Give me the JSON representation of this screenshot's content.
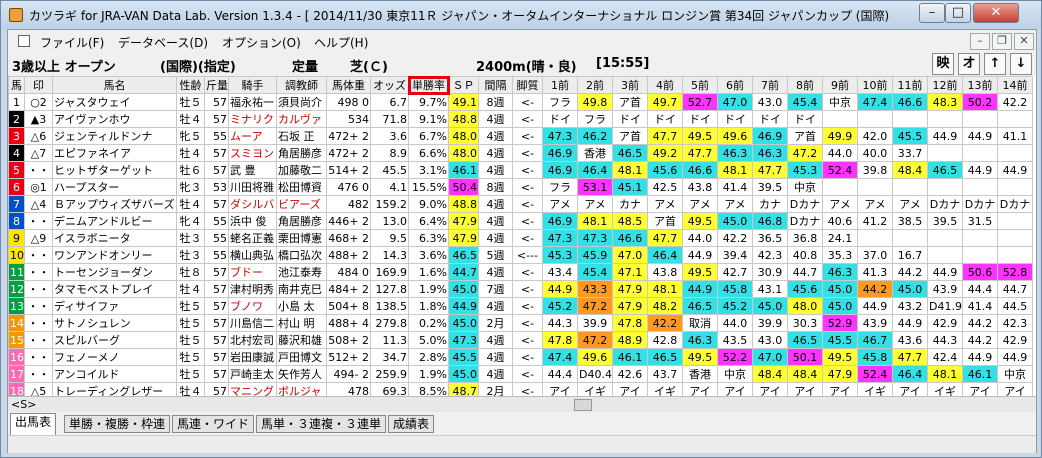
{
  "window": {
    "title": "カツラギ for JRA-VAN Data Lab. Version 1.3.4 - [ 2014/11/30 東京11Ｒ ジャパン・オータムインターナショナル ロンジン賞 第34回 ジャパンカップ (国際)"
  },
  "menu": {
    "items": [
      "ファイル(F)",
      "データベース(D)",
      "オプション(O)",
      "ヘルプ(H)"
    ]
  },
  "race": {
    "class": "3歳以上 オープン",
    "condition": "(国際)(指定)",
    "weight": "定量",
    "surface": "芝(Ｃ)",
    "distance": "2400m(晴・良)",
    "time": "[15:55]"
  },
  "nav": {
    "buttons": [
      "映",
      "オ",
      "↑",
      "↓"
    ]
  },
  "columns": [
    "馬",
    "印",
    "馬名",
    "性齢",
    "斤量",
    "騎手",
    "調教師",
    "馬体重",
    "オッズ",
    "単勝率",
    "ＳＰ",
    "間隔",
    "脚質",
    "1前",
    "2前",
    "3前",
    "4前",
    "5前",
    "6前",
    "7前",
    "8前",
    "9前",
    "10前",
    "11前",
    "12前",
    "13前",
    "14前"
  ],
  "rows": [
    {
      "no": "1",
      "mark": "○2",
      "name": "ジャスタウェイ",
      "sexage": "牡５",
      "kin": "57",
      "jockey": "福永祐一",
      "trainer": "須貝尚介",
      "weight": "498  0",
      "odds": "6.7",
      "rate": "9.7%",
      "sp": "49.1",
      "kankaku": "8週",
      "kyaku": "<-",
      "past": [
        "フラ",
        "49.8",
        "ア首",
        "49.7",
        "52.7",
        "47.0",
        "43.0",
        "45.4",
        "中京",
        "47.4",
        "46.6",
        "48.3",
        "50.2",
        "42.2"
      ]
    },
    {
      "no": "2",
      "mark": "▲3",
      "name": "アイヴァンホウ",
      "sexage": "牡４",
      "kin": "57",
      "jockey": "ミナリク",
      "trainer": "カルヴァ",
      "weight": "534",
      "odds": "71.8",
      "rate": "9.1%",
      "sp": "48.8",
      "kankaku": "4週",
      "kyaku": "<-",
      "past": [
        "ドイ",
        "フラ",
        "ドイ",
        "ドイ",
        "ドイ",
        "ドイ",
        "ドイ",
        "ドイ",
        "",
        "",
        "",
        "",
        "",
        ""
      ]
    },
    {
      "no": "3",
      "mark": "△6",
      "name": "ジェンティルドンナ",
      "sexage": "牝５",
      "kin": "55",
      "jockey": "ムーア",
      "trainer": "石坂  正",
      "weight": "472+ 2",
      "odds": "3.6",
      "rate": "6.7%",
      "sp": "48.0",
      "kankaku": "4週",
      "kyaku": "<-",
      "past": [
        "47.3",
        "46.2",
        "ア首",
        "47.7",
        "49.5",
        "49.6",
        "46.9",
        "ア首",
        "49.9",
        "42.0",
        "45.5",
        "44.9",
        "44.9",
        "41.1"
      ]
    },
    {
      "no": "4",
      "mark": "△7",
      "name": "エピファネイア",
      "sexage": "牡４",
      "kin": "57",
      "jockey": "スミヨン",
      "trainer": "角居勝彦",
      "weight": "472+ 2",
      "odds": "8.9",
      "rate": "6.6%",
      "sp": "48.0",
      "kankaku": "4週",
      "kyaku": "<-",
      "past": [
        "46.9",
        "香港",
        "46.5",
        "49.2",
        "47.7",
        "46.3",
        "46.3",
        "47.2",
        "44.0",
        "40.0",
        "33.7",
        "",
        "",
        ""
      ]
    },
    {
      "no": "5",
      "mark": "・・",
      "name": "ヒットザターゲット",
      "sexage": "牡６",
      "kin": "57",
      "jockey": "武    豊",
      "trainer": "加藤敬二",
      "weight": "514+ 2",
      "odds": "45.5",
      "rate": "3.1%",
      "sp": "46.1",
      "kankaku": "4週",
      "kyaku": "<-",
      "past": [
        "46.9",
        "46.4",
        "48.1",
        "45.6",
        "46.6",
        "48.1",
        "47.7",
        "45.3",
        "52.4",
        "39.8",
        "48.4",
        "46.5",
        "44.9",
        "44.9"
      ]
    },
    {
      "no": "6",
      "mark": "◎1",
      "name": "ハープスター",
      "sexage": "牝３",
      "kin": "53",
      "jockey": "川田将雅",
      "trainer": "松田博資",
      "weight": "476  0",
      "odds": "4.1",
      "rate": "15.5%",
      "sp": "50.4",
      "kankaku": "8週",
      "kyaku": "<-",
      "past": [
        "フラ",
        "53.1",
        "45.1",
        "42.5",
        "43.8",
        "41.4",
        "39.5",
        "中京",
        "",
        "",
        "",
        "",
        "",
        ""
      ]
    },
    {
      "no": "7",
      "mark": "△4",
      "name": "Ｂアップウィズザバーズ",
      "sexage": "牡４",
      "kin": "57",
      "jockey": "ダシルバ",
      "trainer": "ビアーズ",
      "weight": "482",
      "odds": "159.2",
      "rate": "9.0%",
      "sp": "48.8",
      "kankaku": "4週",
      "kyaku": "<-",
      "past": [
        "アメ",
        "アメ",
        "カナ",
        "アメ",
        "アメ",
        "アメ",
        "カナ",
        "Dカナ",
        "アメ",
        "アメ",
        "アメ",
        "Dカナ",
        "Dカナ",
        "Dカナ"
      ]
    },
    {
      "no": "8",
      "mark": "・・",
      "name": "デニムアンドルビー",
      "sexage": "牝４",
      "kin": "55",
      "jockey": "浜中  俊",
      "trainer": "角居勝彦",
      "weight": "446+ 2",
      "odds": "13.0",
      "rate": "6.4%",
      "sp": "47.9",
      "kankaku": "4週",
      "kyaku": "<-",
      "past": [
        "46.9",
        "48.1",
        "48.5",
        "ア首",
        "49.5",
        "45.0",
        "46.8",
        "Dカナ",
        "40.6",
        "41.2",
        "38.5",
        "39.5",
        "31.5",
        ""
      ]
    },
    {
      "no": "9",
      "mark": "△9",
      "name": "イスラボニータ",
      "sexage": "牡３",
      "kin": "55",
      "jockey": "蛯名正義",
      "trainer": "栗田博憲",
      "weight": "468+ 2",
      "odds": "9.5",
      "rate": "6.3%",
      "sp": "47.9",
      "kankaku": "4週",
      "kyaku": "<-",
      "past": [
        "47.3",
        "47.3",
        "46.6",
        "47.7",
        "44.0",
        "42.2",
        "36.5",
        "36.8",
        "24.1",
        "",
        "",
        "",
        "",
        ""
      ]
    },
    {
      "no": "10",
      "mark": "・・",
      "name": "ワンアンドオンリー",
      "sexage": "牡３",
      "kin": "55",
      "jockey": "横山典弘",
      "trainer": "橋口弘次",
      "weight": "488+ 2",
      "odds": "14.3",
      "rate": "3.6%",
      "sp": "46.5",
      "kankaku": "5週",
      "kyaku": "<---",
      "past": [
        "45.3",
        "45.9",
        "47.0",
        "46.4",
        "44.9",
        "39.4",
        "42.3",
        "40.8",
        "35.3",
        "37.0",
        "16.7",
        "",
        "",
        ""
      ]
    },
    {
      "no": "11",
      "mark": "・・",
      "name": "トーセンジョーダン",
      "sexage": "牡８",
      "kin": "57",
      "jockey": "ブドー",
      "trainer": "池江泰寿",
      "weight": "484  0",
      "odds": "169.9",
      "rate": "1.6%",
      "sp": "44.7",
      "kankaku": "4週",
      "kyaku": "<-",
      "past": [
        "43.4",
        "45.4",
        "47.1",
        "43.8",
        "49.5",
        "42.7",
        "30.9",
        "44.7",
        "46.3",
        "41.3",
        "44.2",
        "44.9",
        "50.6",
        "52.8"
      ]
    },
    {
      "no": "12",
      "mark": "・・",
      "name": "タマモベストプレイ",
      "sexage": "牡４",
      "kin": "57",
      "jockey": "津村明秀",
      "trainer": "南井克巳",
      "weight": "484+ 2",
      "odds": "127.8",
      "rate": "1.9%",
      "sp": "45.0",
      "kankaku": "7週",
      "kyaku": "<-",
      "past": [
        "44.9",
        "43.3",
        "47.9",
        "48.1",
        "44.9",
        "45.8",
        "43.1",
        "45.6",
        "45.0",
        "44.2",
        "45.0",
        "43.9",
        "44.4",
        "44.7"
      ]
    },
    {
      "no": "13",
      "mark": "・・",
      "name": "ディサイファ",
      "sexage": "牡５",
      "kin": "57",
      "jockey": "ブノワ",
      "trainer": "小島  太",
      "weight": "504+ 8",
      "odds": "138.5",
      "rate": "1.8%",
      "sp": "44.9",
      "kankaku": "4週",
      "kyaku": "<-",
      "past": [
        "45.2",
        "47.2",
        "47.9",
        "48.2",
        "46.5",
        "45.2",
        "45.0",
        "48.0",
        "45.0",
        "44.9",
        "43.2",
        "D41.9",
        "41.4",
        "44.5"
      ]
    },
    {
      "no": "14",
      "mark": "・・",
      "name": "サトノシュレン",
      "sexage": "牡５",
      "kin": "57",
      "jockey": "川島信二",
      "trainer": "村山  明",
      "weight": "488+ 4",
      "odds": "279.8",
      "rate": "0.2%",
      "sp": "45.0",
      "kankaku": "2月",
      "kyaku": "<-",
      "past": [
        "44.3",
        "39.9",
        "47.8",
        "42.2",
        "取消",
        "44.0",
        "39.9",
        "30.3",
        "52.9",
        "43.9",
        "44.9",
        "42.9",
        "44.2",
        "42.3"
      ]
    },
    {
      "no": "15",
      "mark": "・・",
      "name": "スピルバーグ",
      "sexage": "牡５",
      "kin": "57",
      "jockey": "北村宏司",
      "trainer": "藤沢和雄",
      "weight": "508+ 2",
      "odds": "11.3",
      "rate": "5.0%",
      "sp": "47.3",
      "kankaku": "4週",
      "kyaku": "<-",
      "past": [
        "47.8",
        "47.2",
        "48.9",
        "42.8",
        "46.3",
        "43.5",
        "43.0",
        "46.5",
        "45.5",
        "46.7",
        "43.6",
        "44.3",
        "44.2",
        "42.9"
      ]
    },
    {
      "no": "16",
      "mark": "・・",
      "name": "フェノーメノ",
      "sexage": "牡５",
      "kin": "57",
      "jockey": "岩田康誠",
      "trainer": "戸田博文",
      "weight": "512+ 2",
      "odds": "34.7",
      "rate": "2.8%",
      "sp": "45.5",
      "kankaku": "4週",
      "kyaku": "<-",
      "past": [
        "47.4",
        "49.6",
        "46.1",
        "46.5",
        "49.5",
        "52.2",
        "47.0",
        "50.1",
        "49.5",
        "45.8",
        "47.7",
        "42.4",
        "44.9",
        "44.9"
      ]
    },
    {
      "no": "17",
      "mark": "・・",
      "name": "アンコイルド",
      "sexage": "牡５",
      "kin": "57",
      "jockey": "戸崎圭太",
      "trainer": "矢作芳人",
      "weight": "494- 2",
      "odds": "259.9",
      "rate": "1.9%",
      "sp": "45.0",
      "kankaku": "4週",
      "kyaku": "<-",
      "past": [
        "44.4",
        "D40.4",
        "42.6",
        "43.7",
        "香港",
        "中京",
        "48.4",
        "48.4",
        "47.9",
        "52.4",
        "46.4",
        "48.1",
        "46.1",
        "中京"
      ]
    },
    {
      "no": "18",
      "mark": "△5",
      "name": "トレーディングレザー",
      "sexage": "牡４",
      "kin": "57",
      "jockey": "マニング",
      "trainer": "ボルジャ",
      "weight": "478",
      "odds": "69.3",
      "rate": "8.5%",
      "sp": "48.7",
      "kankaku": "2月",
      "kyaku": "<-",
      "past": [
        "アイ",
        "イギ",
        "アイ",
        "イギ",
        "アイ",
        "アイ",
        "アイ",
        "アイ",
        "アイ",
        "イギ",
        "アイ",
        "イギ",
        "アイ",
        "アイ"
      ]
    }
  ],
  "scroll": {
    "label": "<S>"
  },
  "tabs": [
    "出馬表",
    "単勝・複勝・枠連",
    "馬連・ワイド",
    "馬単・３連複・３連単",
    "成績表"
  ],
  "colors": {
    "frame": [
      "#ffffff",
      "#000000",
      "#e60012",
      "#0050c8",
      "#ffe600",
      "#00a040",
      "#f39800",
      "#ff69b4"
    ],
    "highlight_yellow": "#ffff33",
    "highlight_cyan": "#33e0e6",
    "highlight_magenta": "#ff33ff",
    "highlight_orange": "#ff9922",
    "selected_column_border": "#e60012"
  },
  "past_highlight": [
    [
      "",
      "c-y",
      "",
      "c-y",
      "c-m",
      "c-c",
      "",
      "c-c",
      "",
      "c-c",
      "c-c",
      "c-y",
      "c-m",
      ""
    ],
    [
      "",
      "",
      "",
      "",
      "",
      "",
      "",
      "",
      "",
      "",
      "",
      "",
      "",
      ""
    ],
    [
      "c-c",
      "c-c",
      "",
      "c-y",
      "c-y",
      "c-y",
      "c-c",
      "",
      "c-y",
      "",
      "c-c",
      "",
      "",
      ""
    ],
    [
      "c-c",
      "",
      "c-c",
      "c-y",
      "c-y",
      "c-c",
      "c-c",
      "c-y",
      "",
      "",
      "",
      "",
      "",
      ""
    ],
    [
      "c-c",
      "c-c",
      "c-y",
      "c-c",
      "c-c",
      "c-y",
      "c-y",
      "c-c",
      "c-m",
      "",
      "c-y",
      "c-c",
      "",
      ""
    ],
    [
      "",
      "c-m",
      "c-c",
      "",
      "",
      "",
      "",
      "",
      "",
      "",
      "",
      "",
      "",
      ""
    ],
    [
      "",
      "",
      "",
      "",
      "",
      "",
      "",
      "",
      "",
      "",
      "",
      "",
      "",
      ""
    ],
    [
      "c-c",
      "c-y",
      "c-y",
      "",
      "c-y",
      "c-c",
      "c-c",
      "",
      "",
      "",
      "",
      "",
      "",
      ""
    ],
    [
      "c-c",
      "c-c",
      "c-c",
      "c-y",
      "",
      "",
      "",
      "",
      "",
      "",
      "",
      "",
      "",
      ""
    ],
    [
      "c-c",
      "c-c",
      "c-y",
      "c-c",
      "",
      "",
      "",
      "",
      "",
      "",
      "",
      "",
      "",
      ""
    ],
    [
      "",
      "c-c",
      "c-y",
      "",
      "c-y",
      "",
      "",
      "",
      "c-c",
      "",
      "",
      "",
      "c-m",
      "c-m"
    ],
    [
      "c-y",
      "c-o",
      "c-y",
      "c-y",
      "c-c",
      "c-c",
      "",
      "c-c",
      "c-c",
      "c-o",
      "c-c",
      "",
      "",
      ""
    ],
    [
      "c-c",
      "c-o",
      "c-y",
      "c-y",
      "c-c",
      "c-c",
      "c-c",
      "c-y",
      "c-c",
      "",
      "",
      "",
      "",
      ""
    ],
    [
      "",
      "",
      "c-y",
      "c-o",
      "",
      "",
      "",
      "",
      "c-m",
      "",
      "",
      "",
      "",
      ""
    ],
    [
      "c-y",
      "c-o",
      "c-y",
      "",
      "c-c",
      "",
      "",
      "c-c",
      "c-c",
      "c-c",
      "",
      "",
      "",
      ""
    ],
    [
      "c-c",
      "c-y",
      "c-c",
      "c-c",
      "c-y",
      "c-m",
      "c-c",
      "c-m",
      "c-y",
      "c-c",
      "c-y",
      "",
      "",
      ""
    ],
    [
      "",
      "",
      "",
      "",
      "",
      "",
      "c-y",
      "c-y",
      "c-y",
      "c-m",
      "c-c",
      "c-y",
      "c-c",
      ""
    ],
    [
      "",
      "",
      "",
      "",
      "",
      "",
      "",
      "",
      "",
      "",
      "",
      "",
      "",
      ""
    ]
  ]
}
